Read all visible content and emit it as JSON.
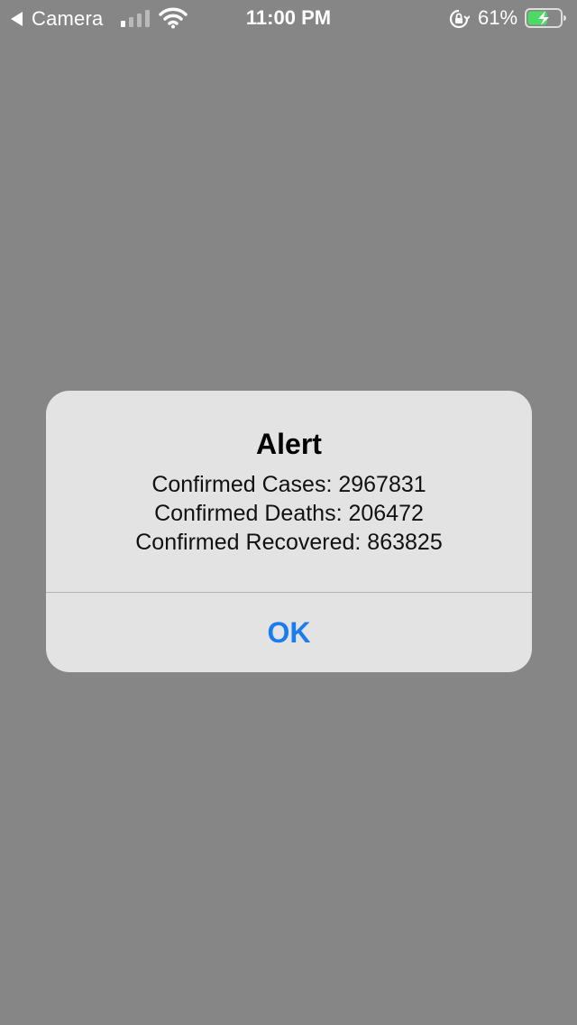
{
  "status_bar": {
    "back_app_label": "Camera",
    "time": "11:00 PM",
    "battery_percent": "61%",
    "battery_level": 0.61,
    "icons": [
      "back-arrow-icon",
      "signal-icon",
      "wifi-icon",
      "rotation-lock-icon",
      "battery-icon"
    ],
    "battery_fill_color": "#4cd964"
  },
  "alert": {
    "title": "Alert",
    "message_lines": [
      "Confirmed Cases: 2967831",
      "Confirmed Deaths: 206472",
      "Confirmed Recovered: 863825"
    ],
    "ok_label": "OK",
    "ok_color": "#1b7cf2"
  }
}
